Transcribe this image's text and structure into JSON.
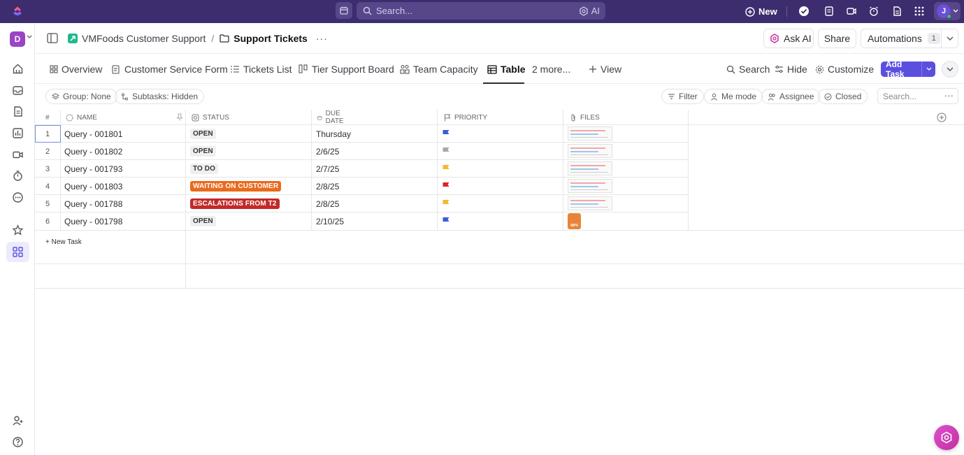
{
  "topbar": {
    "search_placeholder": "Search...",
    "ai_label": "AI",
    "new_label": "New",
    "avatar_initial": "J"
  },
  "workspace": {
    "initial": "D"
  },
  "breadcrumb": {
    "space": "VMFoods Customer Support",
    "separator": "/",
    "list": "Support Tickets",
    "more": "···"
  },
  "header_actions": {
    "ask_ai": "Ask AI",
    "share": "Share",
    "automations": "Automations",
    "automations_count": "1"
  },
  "tabs": [
    {
      "label": "Overview",
      "icon": "overview-icon"
    },
    {
      "label": "Customer Service Form",
      "icon": "form-icon"
    },
    {
      "label": "Tickets List",
      "icon": "list-icon"
    },
    {
      "label": "Tier Support Board",
      "icon": "board-icon"
    },
    {
      "label": "Team Capacity",
      "icon": "capacity-icon"
    },
    {
      "label": "Table",
      "icon": "table-icon",
      "active": true
    },
    {
      "label": "2 more...",
      "icon": ""
    },
    {
      "label": "View",
      "icon": "plus-icon"
    }
  ],
  "view_actions": {
    "search": "Search",
    "hide": "Hide",
    "customize": "Customize",
    "add_task": "Add Task"
  },
  "filters": {
    "group": "Group: None",
    "subtasks": "Subtasks: Hidden",
    "filter": "Filter",
    "me_mode": "Me mode",
    "assignee": "Assignee",
    "closed": "Closed",
    "search_placeholder": "Search..."
  },
  "table": {
    "columns": {
      "num": "#",
      "name": "NAME",
      "status": "STATUS",
      "due_date": "DUE DATE",
      "priority": "PRIORITY",
      "files": "FILES"
    },
    "rows": [
      {
        "num": "1",
        "name": "Query - 001801",
        "status": "OPEN",
        "status_bg": "#efefef",
        "status_fg": "#333333",
        "due": "Thursday",
        "flag_color": "#3b5bdb",
        "file": "image"
      },
      {
        "num": "2",
        "name": "Query - 001802",
        "status": "OPEN",
        "status_bg": "#efefef",
        "status_fg": "#333333",
        "due": "2/6/25",
        "flag_color": "#a8a8a8",
        "file": "image"
      },
      {
        "num": "3",
        "name": "Query - 001793",
        "status": "TO DO",
        "status_bg": "#efefef",
        "status_fg": "#333333",
        "due": "2/7/25",
        "flag_color": "#f5b82e",
        "file": "image"
      },
      {
        "num": "4",
        "name": "Query - 001803",
        "status": "WAITING ON CUSTOMER",
        "status_bg": "#ea6a1c",
        "status_fg": "#ffffff",
        "due": "2/8/25",
        "flag_color": "#d92525",
        "file": "image"
      },
      {
        "num": "5",
        "name": "Query - 001788",
        "status": "ESCALATIONS FROM T2",
        "status_bg": "#c22a2a",
        "status_fg": "#ffffff",
        "due": "2/8/25",
        "flag_color": "#f5b82e",
        "file": "image"
      },
      {
        "num": "6",
        "name": "Query - 001798",
        "status": "OPEN",
        "status_bg": "#efefef",
        "status_fg": "#333333",
        "due": "2/10/25",
        "flag_color": "#3b5bdb",
        "file": "mp4"
      }
    ],
    "new_task": "+ New Task",
    "mp4_label": "MP4"
  },
  "colors": {
    "topbar": "#3d2d6e",
    "accent": "#5b4fe0"
  }
}
